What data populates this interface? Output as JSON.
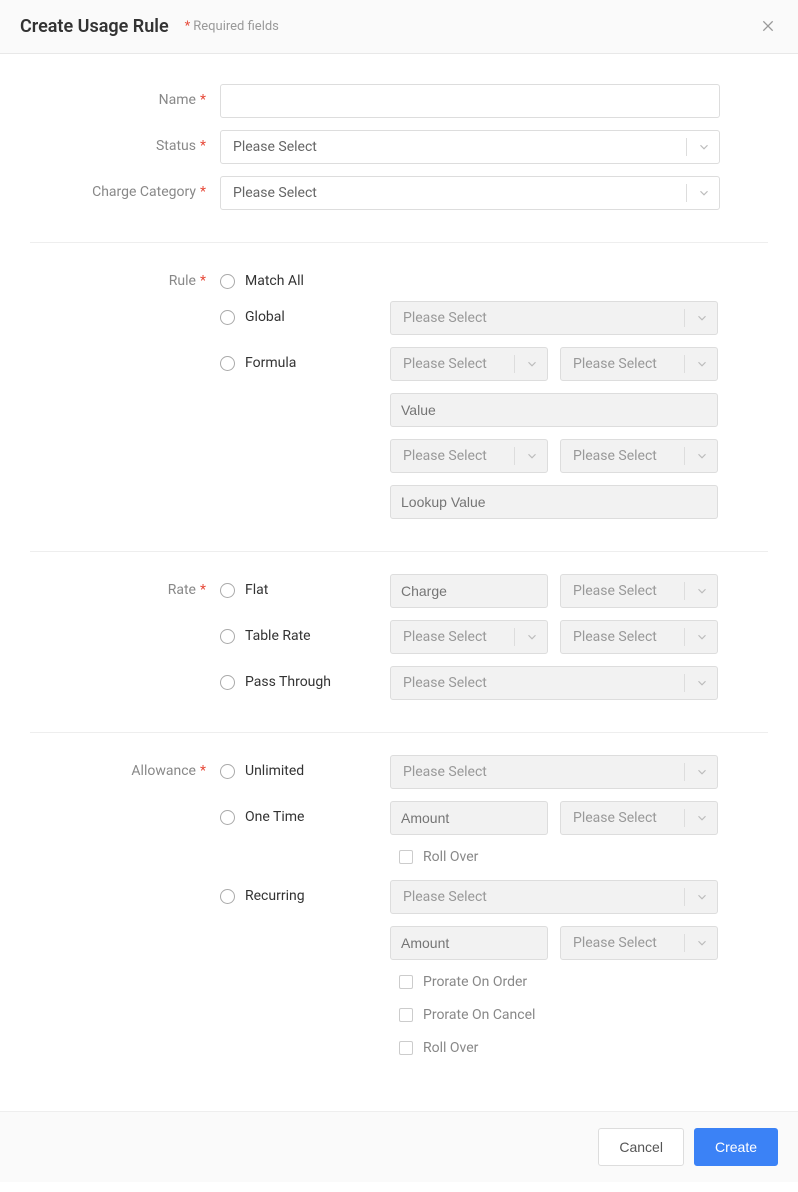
{
  "header": {
    "title": "Create Usage Rule",
    "required_note": "Required fields"
  },
  "labels": {
    "name": "Name",
    "status": "Status",
    "charge_category": "Charge Category",
    "rule": "Rule",
    "rate": "Rate",
    "allowance": "Allowance"
  },
  "placeholders": {
    "please_select": "Please Select",
    "value": "Value",
    "lookup_value": "Lookup Value",
    "charge": "Charge",
    "amount": "Amount"
  },
  "radios": {
    "match_all": "Match All",
    "global": "Global",
    "formula": "Formula",
    "flat": "Flat",
    "table_rate": "Table Rate",
    "pass_through": "Pass Through",
    "unlimited": "Unlimited",
    "one_time": "One Time",
    "recurring": "Recurring"
  },
  "checkboxes": {
    "roll_over": "Roll Over",
    "prorate_on_order": "Prorate On Order",
    "prorate_on_cancel": "Prorate On Cancel"
  },
  "footer": {
    "cancel": "Cancel",
    "create": "Create"
  }
}
